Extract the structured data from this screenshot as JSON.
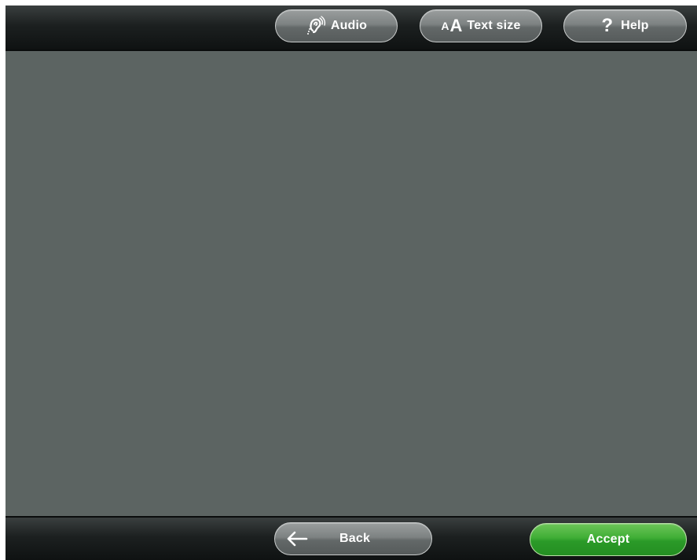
{
  "toolbar": {
    "audio_label": "Audio",
    "text_size_label": "Text size",
    "text_size_icon_small": "A",
    "text_size_icon_big": "A",
    "help_label": "Help",
    "help_icon_glyph": "?"
  },
  "footer": {
    "back_label": "Back",
    "accept_label": "Accept"
  },
  "icons": {
    "audio": "hearing-ear-icon",
    "text_size": "text-size-icon",
    "help": "question-mark-icon",
    "back": "arrow-left-icon"
  },
  "colors": {
    "content_background": "#5c6462",
    "bar_background": "#1c2020",
    "accept_green": "#3fae35"
  }
}
